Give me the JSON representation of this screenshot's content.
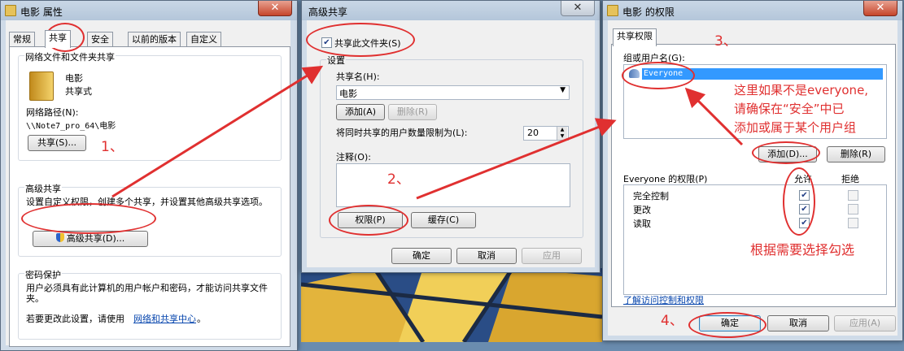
{
  "props": {
    "title": "电影 属性",
    "tabs": [
      "常规",
      "共享",
      "安全",
      "以前的版本",
      "自定义"
    ],
    "net_group_label": "网络文件和文件夹共享",
    "folder_name": "电影",
    "folder_state": "共享式",
    "path_label": "网络路径(N):",
    "path_value": "\\\\Note7_pro_64\\电影",
    "share_btn": "共享(S)...",
    "adv_group_label": "高级共享",
    "adv_desc": "设置自定义权限，创建多个共享，并设置其他高级共享选项。",
    "adv_btn": "高级共享(D)...",
    "pwd_group_label": "密码保护",
    "pwd_desc": "用户必须具有此计算机的用户帐户和密码，才能访问共享文件夹。",
    "pwd_link_prefix": "若要更改此设置，请使用",
    "pwd_link": "网络和共享中心",
    "pwd_link_suffix": "。",
    "close": "✕"
  },
  "adv": {
    "title": "高级共享",
    "share_check_label": "共享此文件夹(S)",
    "settings_label": "设置",
    "share_name_label": "共享名(H):",
    "share_name_value": "电影",
    "add_btn": "添加(A)",
    "remove_btn": "删除(R)",
    "limit_label": "将同时共享的用户数量限制为(L):",
    "limit_value": "20",
    "comment_label": "注释(O):",
    "perm_btn": "权限(P)",
    "cache_btn": "缓存(C)",
    "ok": "确定",
    "cancel": "取消",
    "apply": "应用",
    "close": "✕"
  },
  "perm": {
    "title": "电影 的权限",
    "tab": "共享权限",
    "group_label": "组或用户名(G):",
    "user": "Everyone",
    "add_btn": "添加(D)...",
    "remove_btn": "删除(R)",
    "perm_for": "Everyone 的权限(P)",
    "allow": "允许",
    "deny": "拒绝",
    "rows": [
      {
        "name": "完全控制",
        "allow": true,
        "deny": false
      },
      {
        "name": "更改",
        "allow": true,
        "deny": false
      },
      {
        "name": "读取",
        "allow": true,
        "deny": false
      }
    ],
    "link": "了解访问控制和权限",
    "ok": "确定",
    "cancel": "取消",
    "apply": "应用(A)",
    "close": "✕"
  },
  "annotations": {
    "step1": "1、",
    "step2": "2、",
    "step3": "3、",
    "step4": "4、",
    "note1_line1": "这里如果不是everyone,",
    "note1_line2": "请确保在“安全”中已",
    "note1_line3": "添加或属于某个用户组",
    "note2": "根据需要选择勾选"
  },
  "colors": {
    "annotation": "#e03030",
    "selection": "#3399ff"
  }
}
